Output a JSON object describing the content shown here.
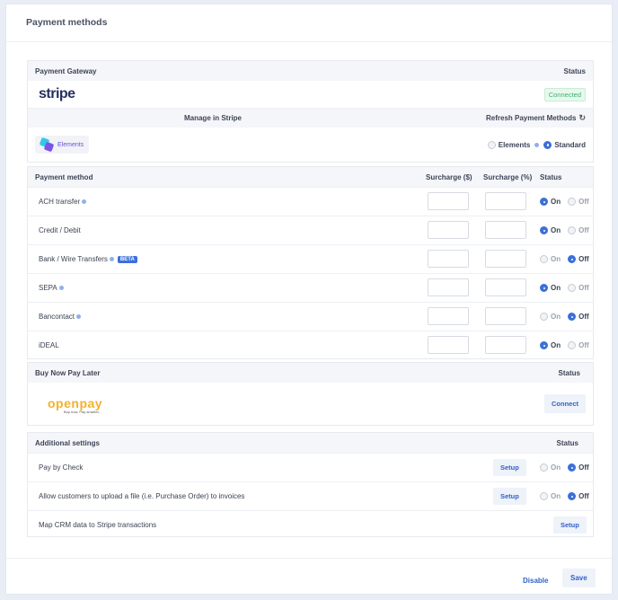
{
  "page": {
    "title": "Payment methods"
  },
  "gateway": {
    "header_label": "Payment Gateway",
    "status_label": "Status",
    "logo_text": "stripe",
    "status_badge": "Connected"
  },
  "stripe": {
    "manage_label": "Manage in Stripe",
    "refresh_label": "Refresh Payment Methods",
    "elements_chip": "Elements",
    "mode_options": [
      {
        "label": "Elements",
        "selected": false
      },
      {
        "label": "Standard",
        "selected": true
      }
    ]
  },
  "payment_methods": {
    "columns": [
      "Payment method",
      "Surcharge ($)",
      "Surcharge (%)",
      "Status"
    ],
    "on_label": "On",
    "off_label": "Off",
    "rows": [
      {
        "name": "ACH transfer",
        "info": true,
        "beta": "",
        "status": "On"
      },
      {
        "name": "Credit / Debit",
        "info": false,
        "beta": "",
        "status": "On"
      },
      {
        "name": "Bank / Wire Transfers",
        "info": true,
        "beta": "BETA",
        "status": "Off"
      },
      {
        "name": "SEPA",
        "info": true,
        "beta": "",
        "status": "On"
      },
      {
        "name": "Bancontact",
        "info": true,
        "beta": "",
        "status": "Off"
      },
      {
        "name": "iDEAL",
        "info": false,
        "beta": "",
        "status": "On"
      }
    ]
  },
  "bnpl": {
    "header_label": "Buy Now Pay Later",
    "status_label": "Status",
    "provider_name": "openpay",
    "provider_tagline": "Buy now. Pay smarter.",
    "connect_button": "Connect"
  },
  "additional": {
    "header_label": "Additional settings",
    "status_label": "Status",
    "setup_label": "Setup",
    "rows": [
      {
        "name": "Pay by Check",
        "status": "Off"
      },
      {
        "name": "Allow customers to upload a file (i.e. Purchase Order) to invoices",
        "status": "Off"
      },
      {
        "name": "Map CRM data to Stripe transactions",
        "status": ""
      }
    ]
  },
  "footer": {
    "disable_button": "Disable",
    "save_button": "Save"
  },
  "colors": {
    "accent": "#3d6fd9",
    "connected_green": "#39b46b",
    "openpay_yellow": "#f3b12a"
  }
}
